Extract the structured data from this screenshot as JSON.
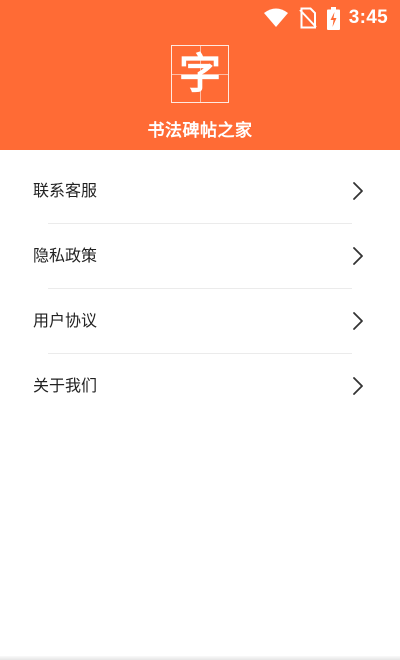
{
  "status_bar": {
    "time": "3:45",
    "icons": [
      "wifi-icon",
      "no-sim-icon",
      "battery-charging-icon"
    ]
  },
  "header": {
    "logo_glyph": "字",
    "app_name": "书法碑帖之家",
    "background_color": "#ff6b35"
  },
  "menu": {
    "items": [
      {
        "label": "联系客服",
        "icon": "chevron-right-icon"
      },
      {
        "label": "隐私政策",
        "icon": "chevron-right-icon"
      },
      {
        "label": "用户协议",
        "icon": "chevron-right-icon"
      },
      {
        "label": "关于我们",
        "icon": "chevron-right-icon"
      }
    ]
  }
}
